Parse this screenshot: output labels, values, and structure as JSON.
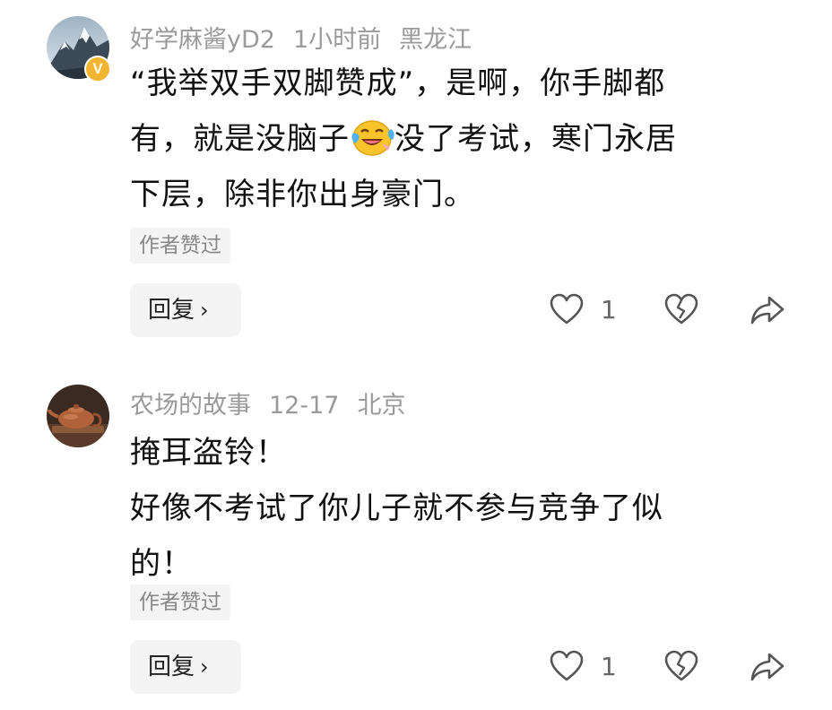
{
  "comments": [
    {
      "username": "好学麻酱yD2",
      "time": "1小时前",
      "location": "黑龙江",
      "lines": [
        "“我举双手双脚赞成”，是啊，你手脚都",
        "有，就是没脑子",
        "没了考试，寒门永居",
        "下层，除非你出身豪门。"
      ],
      "emoji": "laughing-crying-emoji",
      "verified_badge": "V",
      "author_liked": "作者赞过",
      "reply_label": "回复",
      "reply_chevron": "›",
      "like_count": "1"
    },
    {
      "username": "农场的故事",
      "time": "12-17",
      "location": "北京",
      "lines": [
        "掩耳盗铃！",
        "好像不考试了你儿子就不参与竞争了似",
        "的！"
      ],
      "author_liked": "作者赞过",
      "reply_label": "回复",
      "reply_chevron": "›",
      "like_count": "1"
    }
  ],
  "icons": {
    "like": "heart-outline-icon",
    "dislike": "broken-heart-icon",
    "share": "share-arrow-icon"
  },
  "colors": {
    "meta_text": "#9a9a9a",
    "body_text": "#111111",
    "chip_bg": "#f4f4f4",
    "icon_stroke": "#555555",
    "verified_badge": "#f2b531"
  }
}
